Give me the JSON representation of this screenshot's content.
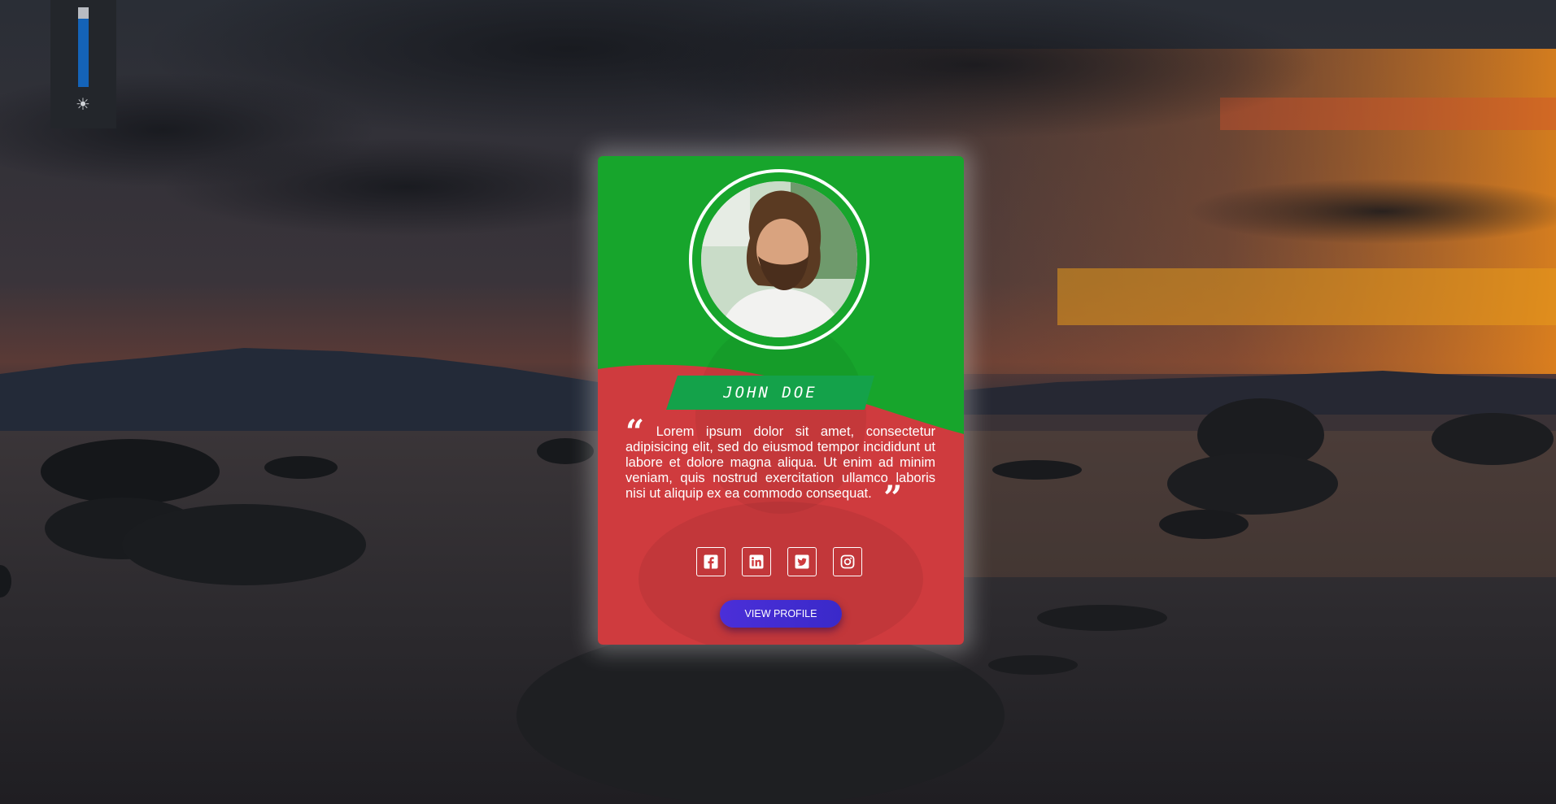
{
  "brightness": {
    "level": 0.88,
    "icon": "sun-icon"
  },
  "card": {
    "name": "JOHN DOE",
    "quote": "Lorem ipsum dolor sit amet, consectetur adipisicing elit, sed do eiusmod tempor incididunt ut labore et dolore magna aliqua. Ut enim ad minim veniam, quis nostrud exercitation ullamco laboris nisi ut aliquip ex ea commodo consequat.",
    "quote_open": "“",
    "quote_close": "”",
    "socials": [
      {
        "icon": "facebook-icon"
      },
      {
        "icon": "linkedin-icon"
      },
      {
        "icon": "twitter-icon"
      },
      {
        "icon": "instagram-icon"
      }
    ],
    "button_label": "VIEW PROFILE",
    "colors": {
      "top": "#17a52c",
      "bottom": "#cf3b3e",
      "banner": "#14a24a",
      "button": "#4530d4"
    }
  }
}
